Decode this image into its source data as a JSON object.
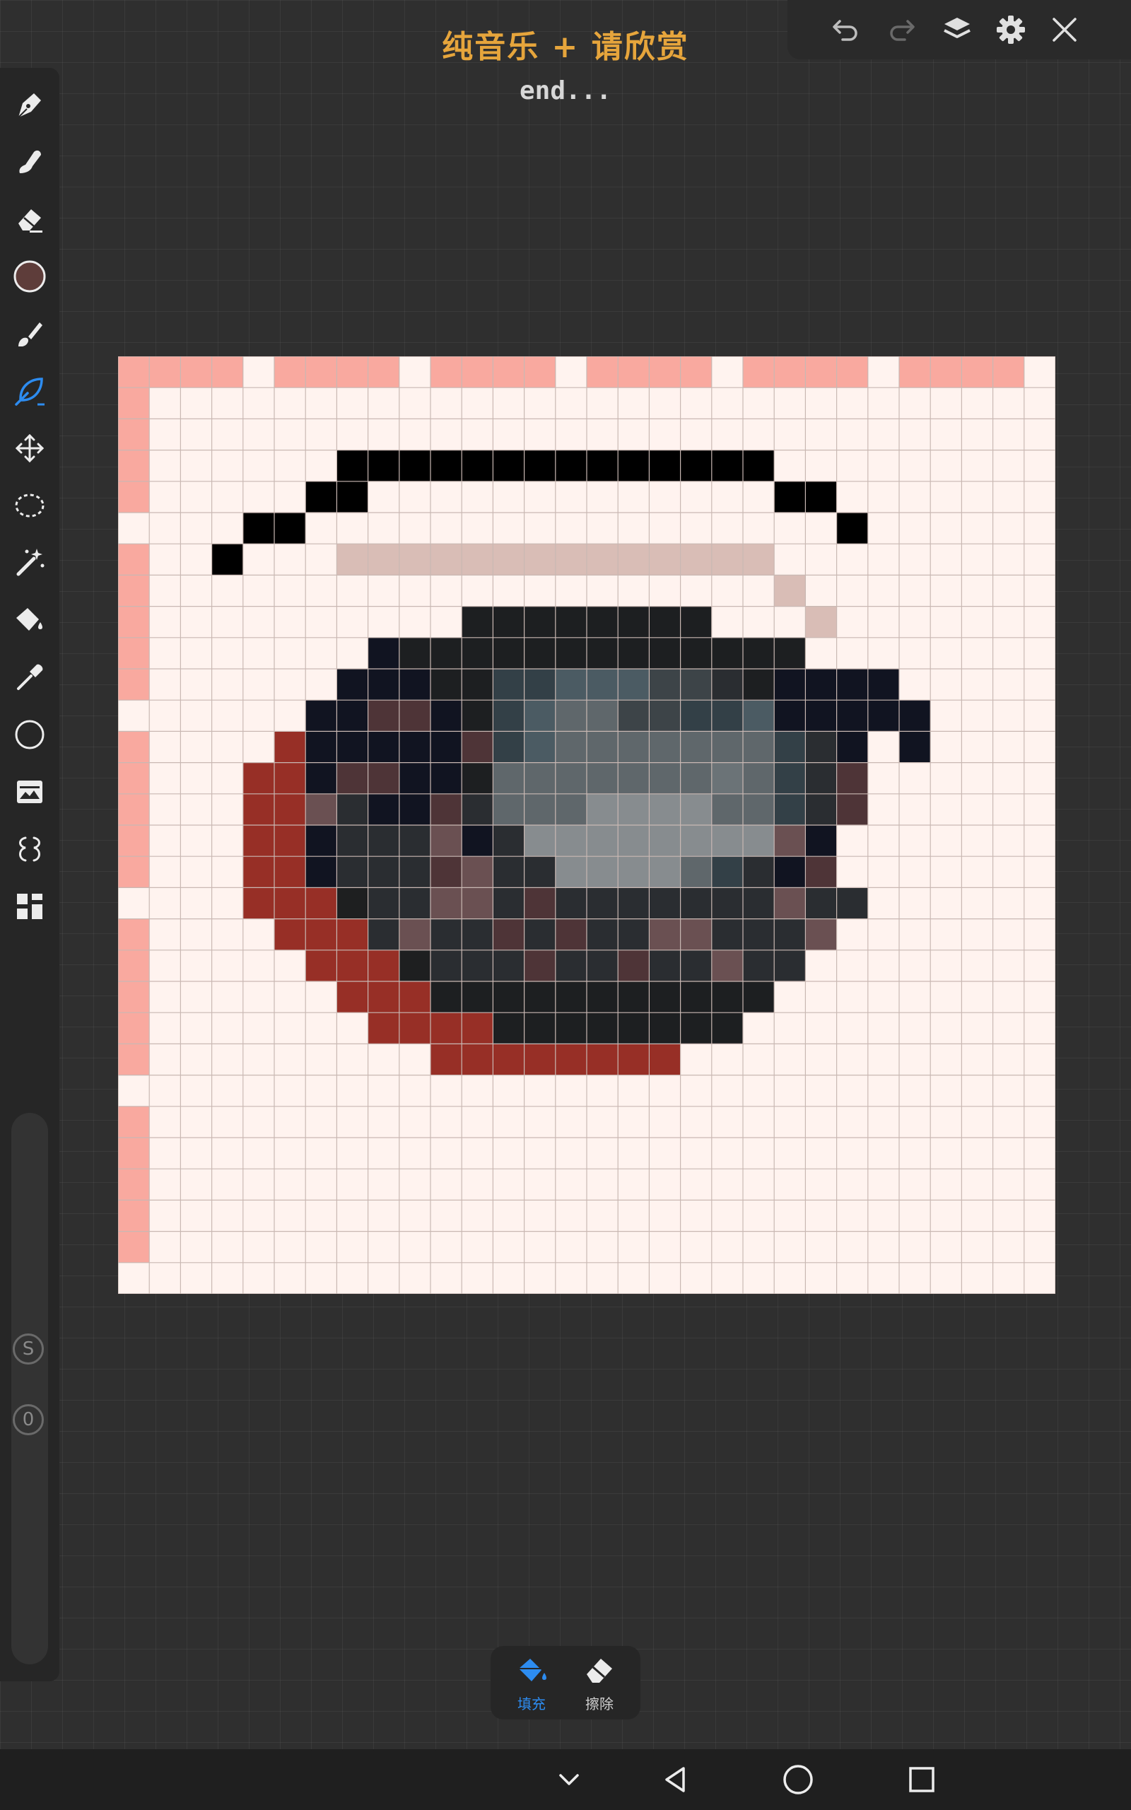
{
  "header": {
    "title": "纯音乐 + 请欣赏",
    "subtitle": "end..."
  },
  "topbar": {
    "icons": [
      "undo-icon",
      "redo-icon",
      "layers-icon",
      "settings-icon",
      "close-icon"
    ]
  },
  "toolbar": {
    "tools": [
      "pen-icon",
      "smudge-icon",
      "eraser-icon",
      "color-swatch",
      "brush-icon",
      "leaf-pen-icon",
      "move-icon",
      "lasso-icon",
      "magic-wand-icon",
      "fill-bucket-icon",
      "eyedropper-icon",
      "circle-shape-icon",
      "image-icon",
      "symmetry-icon",
      "grid-apps-icon"
    ],
    "active_tool": "leaf-pen-icon",
    "current_color": "#5e3d3a",
    "size_badge": "S",
    "opacity_badge": "0"
  },
  "canvas": {
    "grid_size": 30,
    "palette": {
      "w": "#fff3ef",
      "p": "#f9a99f",
      "k": "#000000",
      "t": "#d9bdb6",
      "d": "#1d1f21",
      "n": "#111421",
      "a": "#2a2d31",
      "c": "#334047",
      "e": "#3d4448",
      "s": "#4b5b63",
      "g": "#5f676b",
      "m": "#6b7377",
      "l": "#878c8f",
      "r": "#972f26",
      "b": "#4e3437",
      "f": "#6a5052",
      "x": "#1e1f20"
    },
    "rows": [
      "ppppwppppwppppwppppwppppwppppw",
      "pwwwwwwwwwwwwwwwwwwwwwwwwwwwww",
      "pwwwwwwwwwwwwwwwwwwwwwwwwwwwww",
      "pwwwwwwkkkkkkkkkkkkkkwwwwwwwww",
      "pwwwwwkkwwwwwwwwwwwwwkkwwwwwww",
      "wwwwkkwwwwwwwwwwwwwwwwwkwwwwww",
      "pwwkwwwttttttttttttttwwwwwwwww",
      "pwwwwwwwwwwwwwwwwwwwwtwwwwwwww",
      "pwwwwwwwwwwddddddddwwwtwwwwwww",
      "pwwwwwwwndddddddddddddwwwwwwww",
      "pwwwwwwnnnddccssseeadnnnnwwwww",
      "wwwwwwnnbbndcsggeeccsnnnnnwwww",
      "pwwwwrnnnnnbcsgggggggcanwnwwww",
      "pwwwrrnbbnndgggggggmgcabwwwwww",
      "pwwwrrfannbagggllllggcabwwwwww",
      "pwwwrrnaaafnallllllllfnwwwwwww",
      "pwwwrrnaaabfaallllgcanbwwwwwww",
      "wwwwrrrxaaffabaaaaaaaf aawwwwwww",
      "pwwwwrrrafaababaaffaaafwwwwwww",
      "pwwwwwrrrxaaabaabaafaawwwwwwww",
      "pwwwwwwrrrdddddddddddwwwwwwwww",
      "pwwwwwwwrrrrddddddddwwwwwwwwww",
      "pwwwwwwwwwrrrrrrrrwwwwwwwwwwww",
      "wwwwwwwwwwwwwwwwwwwwwwwwwwwwww",
      "pwwwwwwwwwwwwwwwwwwwwwwwwwwwww",
      "pwwwwwwwwwwwwwwwwwwwwwwwwwwwww",
      "pwwwwwwwwwwwwwwwwwwwwwwwwwwwww",
      "pwwwwwwwwwwwwwwwwwwwwwwwwwwwww",
      "pwwwwwwwwwwwwwwwwwwwwwwwwwwwww",
      "wwwwwwwwwwwwwwwwwwwwwwwwwwwwww"
    ]
  },
  "bottom_tools": {
    "fill": {
      "label": "填充",
      "icon": "paint-bucket-icon",
      "color": "#2d8cf0"
    },
    "erase": {
      "label": "擦除",
      "icon": "eraser-icon",
      "color": "#cfcfcf"
    }
  },
  "navbar": {
    "icons": [
      "chevron-down-icon",
      "back-icon",
      "home-icon",
      "recents-icon"
    ]
  }
}
